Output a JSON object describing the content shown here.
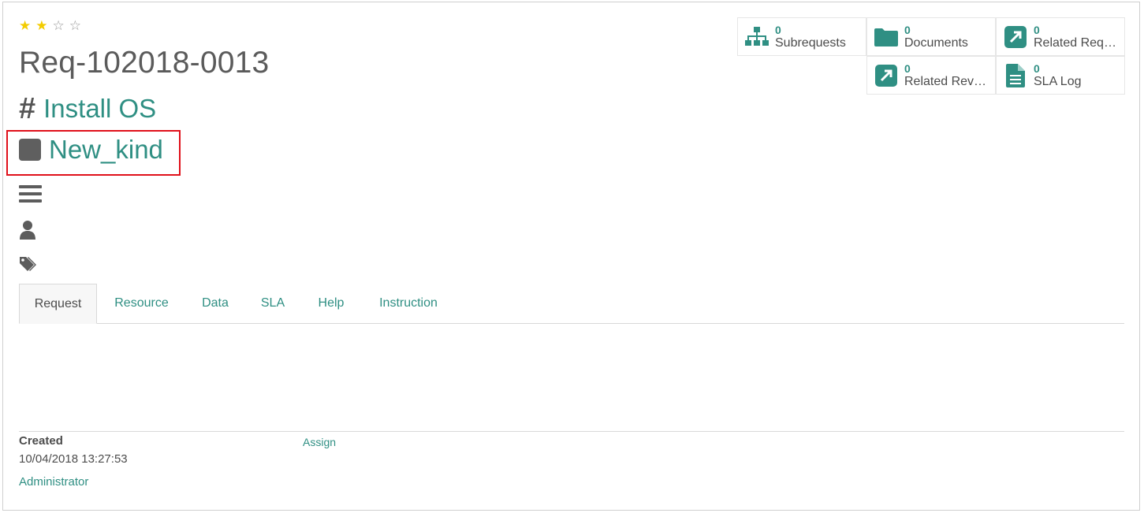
{
  "rating": {
    "filled": 2,
    "total": 4
  },
  "request": {
    "number": "Req-102018-0013",
    "name": "Install OS",
    "kind": "New_kind"
  },
  "smart_buttons": {
    "subrequests": {
      "count": "0",
      "label": "Subrequests",
      "icon": "sitemap-icon"
    },
    "documents": {
      "count": "0",
      "label": "Documents",
      "icon": "folder-icon"
    },
    "related_requests": {
      "count": "0",
      "label": "Related Requ...",
      "icon": "external-link-icon"
    },
    "related_reverse": {
      "count": "0",
      "label": "Related Rever...",
      "icon": "external-link-icon"
    },
    "sla_log": {
      "count": "0",
      "label": "SLA Log",
      "icon": "file-text-icon"
    }
  },
  "tabs": [
    "Request",
    "Resource",
    "Data",
    "SLA",
    "Help",
    "Instruction"
  ],
  "footer": {
    "created_label": "Created",
    "created_value": "10/04/2018 13:27:53",
    "created_by": "Administrator",
    "assign_label": "Assign"
  },
  "colors": {
    "accent": "#2f8f83",
    "star": "#f3cc00",
    "highlight": "#e0101a"
  }
}
